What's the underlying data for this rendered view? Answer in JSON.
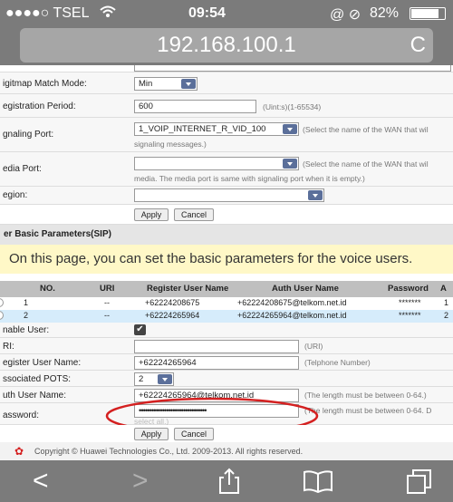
{
  "status": {
    "carrier": "●●●●○ TSEL",
    "wifi": "WiFi",
    "time": "09:54",
    "icons": "@ ⊘",
    "battery": "82%"
  },
  "browser": {
    "url": "192.168.100.1",
    "reload": "C"
  },
  "settings": {
    "digitmap_label": "igitmap Match Mode:",
    "digitmap_value": "Min",
    "reg_period_label": "egistration Period:",
    "reg_period_value": "600",
    "reg_period_hint": "(Uint:s)(1-65534)",
    "signaling_port_label": "gnaling Port:",
    "signaling_port_value": "1_VOIP_INTERNET_R_VID_100",
    "signaling_hint": "(Select the name of the WAN that wil",
    "signaling_hint2": "signaling messages.)",
    "media_port_label": "edia Port:",
    "media_hint": "(Select the name of the WAN that wil",
    "media_hint2": "media. The media port is same with signaling port when it is empty.)",
    "region_label": "egion:",
    "apply": "Apply",
    "cancel": "Cancel"
  },
  "section_title": "er Basic Parameters(SIP)",
  "banner": "On this page, you can set the basic parameters for the voice users.",
  "table": {
    "headers": [
      "NO.",
      "URI",
      "Register User Name",
      "Auth User Name",
      "Password",
      "A"
    ],
    "rows": [
      {
        "no": "1",
        "uri": "--",
        "reg": "+62224208675",
        "auth": "+62224208675@telkom.net.id",
        "pass": "*******",
        "a": "1"
      },
      {
        "no": "2",
        "uri": "--",
        "reg": "+62224265964",
        "auth": "+62224265964@telkom.net.id",
        "pass": "*******",
        "a": "2"
      }
    ]
  },
  "form": {
    "enable_label": "nable User:",
    "uri_label": "RI:",
    "uri_hint": "(URI)",
    "reg_name_label": "egister User Name:",
    "reg_name_value": "+62224265964",
    "reg_name_hint": "(Telphone Number)",
    "pots_label": "ssociated POTS:",
    "pots_value": "2",
    "auth_label": "uth User Name:",
    "auth_value": "+62224265964@telkom.net.id",
    "auth_hint": "(The length must be between 0-64.)",
    "password_label": "assword:",
    "password_value": "••••••••••••••••••••••••••••••••",
    "password_hint": "(The length must be between 0-64. D",
    "password_hint2": "select all.)",
    "apply": "Apply",
    "cancel": "Cancel"
  },
  "footer": "Copyright © Huawei Technologies Co., Ltd. 2009-2013. All rights reserved.",
  "colors": {
    "highlight_circle": "#d42020",
    "selected_row": "#d6ecfb",
    "banner": "#fff8c7"
  }
}
